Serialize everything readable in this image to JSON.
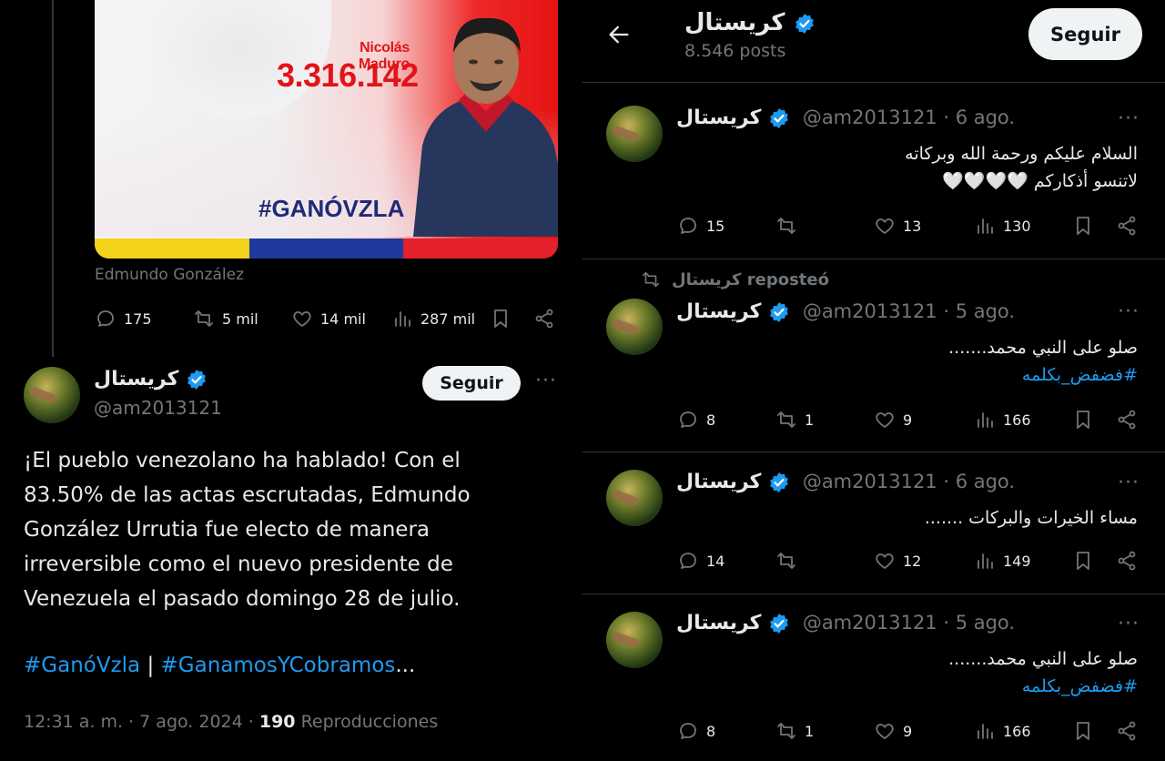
{
  "left": {
    "media": {
      "candidate_name": "Nicolás Maduro",
      "candidate_votes": "3.316.142",
      "hashtag": "#GANÓVZLA",
      "flag_colors": [
        "#f4d21a",
        "#1e3a9e",
        "#e4202a"
      ]
    },
    "caption": "Edmundo González",
    "quoted_stats": {
      "replies": "175",
      "reposts": "5 mil",
      "likes": "14 mil",
      "views": "287 mil"
    },
    "tweet": {
      "display_name": "كريستال",
      "handle": "@am2013121",
      "follow_label": "Seguir",
      "text": "¡El pueblo venezolano ha hablado! Con el 83.50% de las actas escrutadas, Edmundo González Urrutia fue electo de manera irreversible como el nuevo presidente de Venezuela el pasado domingo 28 de julio.",
      "tag1": "#GanóVzla",
      "separator": "|",
      "tag2": "#GanamosYCobramos",
      "ellipsis": "...",
      "timestamp": "12:31 a. m. · 7 ago. 2024 · ",
      "views_count": "190",
      "views_label": " Reproducciones"
    }
  },
  "right": {
    "header": {
      "title": "كريستال",
      "posts": "8.546 posts",
      "follow_label": "Seguir"
    },
    "repost_label": "كريستال reposteó",
    "posts": [
      {
        "name": "كريستال",
        "handle": "@am2013121 · 6 ago.",
        "line1": "السلام عليكم ورحمة الله وبركاته",
        "line2": "لاتنسو أذكاركم 🤍🤍🤍🤍",
        "tag": "",
        "replies": "15",
        "reposts": "",
        "likes": "13",
        "views": "130"
      },
      {
        "name": "كريستال",
        "handle": "@am2013121 · 5 ago.",
        "line1": "صلو على النبي محمد.......",
        "line2": "",
        "tag": "#فضفض_بكلمه",
        "replies": "8",
        "reposts": "1",
        "likes": "9",
        "views": "166"
      },
      {
        "name": "كريستال",
        "handle": "@am2013121 · 6 ago.",
        "line1": "مساء الخيرات والبركات .......",
        "line2": "",
        "tag": "",
        "replies": "14",
        "reposts": "",
        "likes": "12",
        "views": "149"
      },
      {
        "name": "كريستال",
        "handle": "@am2013121 · 5 ago.",
        "line1": "صلو على النبي محمد.......",
        "line2": "",
        "tag": "#فضفض_بكلمه",
        "replies": "8",
        "reposts": "1",
        "likes": "9",
        "views": "166"
      }
    ]
  },
  "colors": {
    "accent": "#1d9bf0",
    "muted": "#71767b",
    "text": "#e7e9ea",
    "background": "#000000"
  }
}
